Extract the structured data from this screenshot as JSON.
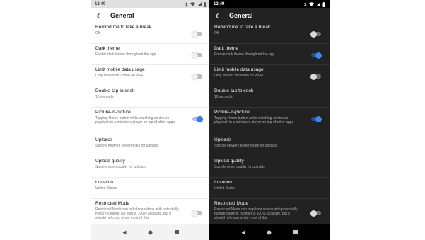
{
  "status": {
    "time": "12:49"
  },
  "header": {
    "title": "General"
  },
  "settings": [
    {
      "label": "Remind me to take a break",
      "sub": "Off"
    },
    {
      "label": "Dark theme",
      "sub": "Enable dark theme throughout the app"
    },
    {
      "label": "Limit mobile data usage",
      "sub": "Only stream HD video on Wi-Fi"
    },
    {
      "label": "Double-tap to seek",
      "sub": "10 seconds"
    },
    {
      "label": "Picture-in-picture",
      "sub": "Tapping Home button while watching continues playback in a miniature player on top of other apps"
    },
    {
      "label": "Uploads",
      "sub": "Specify network preferences for uploads"
    },
    {
      "label": "Upload quality",
      "sub": "Specify video quality for uploads"
    },
    {
      "label": "Location",
      "sub": "United States"
    },
    {
      "label": "Restricted Mode",
      "sub": "Restricted Mode can help hide videos with potentially mature content. No filter is 100% accurate, but it should help you avoid most of this"
    }
  ],
  "toggles": {
    "light": {
      "remind_break": false,
      "dark_theme": false,
      "limit_mobile_data": false,
      "picture_in_picture": true,
      "restricted_mode": false
    },
    "dark": {
      "remind_break": false,
      "dark_theme": true,
      "limit_mobile_data": false,
      "picture_in_picture": true,
      "restricted_mode": false
    }
  },
  "colors": {
    "accent": "#3e78ea",
    "dark_background": "#222222",
    "light_background": "#ffffff"
  },
  "icons": {
    "back": "arrow-left-icon",
    "nav_back": "triangle-back-icon",
    "nav_home": "circle-home-icon",
    "nav_recents": "square-recents-icon"
  }
}
